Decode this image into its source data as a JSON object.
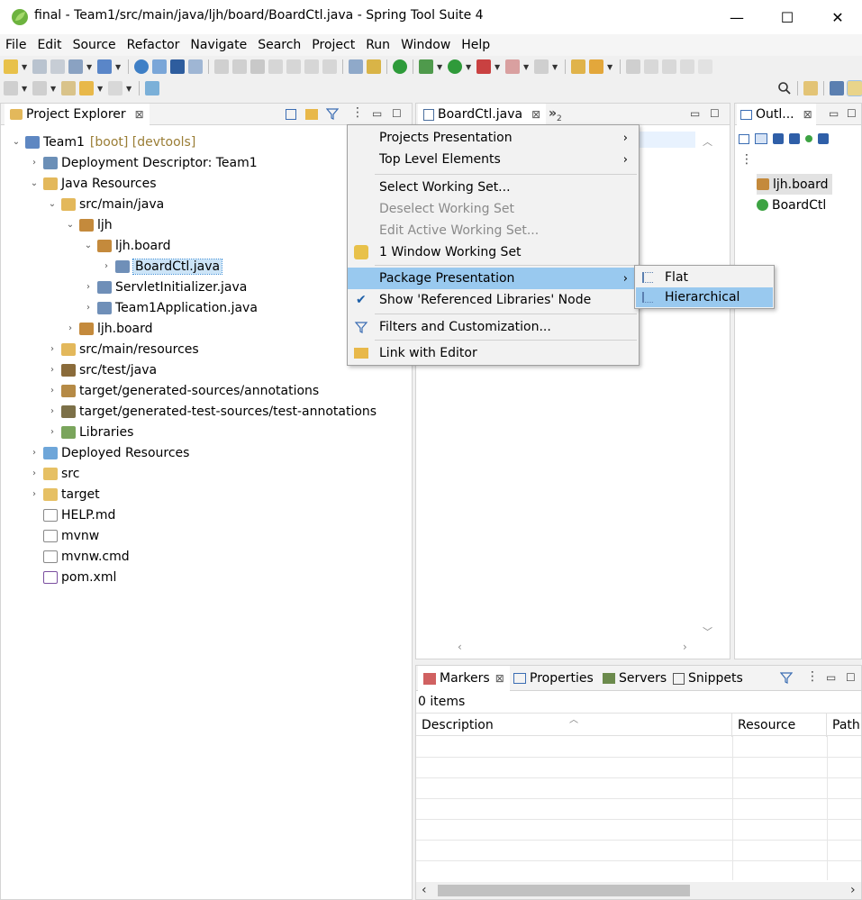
{
  "window": {
    "title": "final - Team1/src/main/java/ljh/board/BoardCtl.java - Spring Tool Suite 4",
    "minimize": "—",
    "maximize": "☐",
    "close": "✕"
  },
  "menubar": [
    "File",
    "Edit",
    "Source",
    "Refactor",
    "Navigate",
    "Search",
    "Project",
    "Run",
    "Window",
    "Help"
  ],
  "project_explorer": {
    "tab_label": "Project Explorer",
    "tab_close": "⊠",
    "tree": [
      {
        "label": "Team1",
        "decoration": "[boot] [devtools]",
        "expanded": true
      },
      {
        "label": "Deployment Descriptor: Team1"
      },
      {
        "label": "Java Resources",
        "expanded": true
      },
      {
        "label": "src/main/java",
        "expanded": true
      },
      {
        "label": "ljh",
        "expanded": true
      },
      {
        "label": "ljh.board",
        "expanded": true
      },
      {
        "label": "BoardCtl.java",
        "selected": true
      },
      {
        "label": "ServletInitializer.java"
      },
      {
        "label": "Team1Application.java"
      },
      {
        "label": "ljh.board"
      },
      {
        "label": "src/main/resources"
      },
      {
        "label": "src/test/java"
      },
      {
        "label": "target/generated-sources/annotations"
      },
      {
        "label": "target/generated-test-sources/test-annotations"
      },
      {
        "label": "Libraries"
      },
      {
        "label": "Deployed Resources"
      },
      {
        "label": "src"
      },
      {
        "label": "target"
      },
      {
        "label": "HELP.md"
      },
      {
        "label": "mvnw"
      },
      {
        "label": "mvnw.cmd"
      },
      {
        "label": "pom.xml"
      }
    ]
  },
  "editor": {
    "tab_label": "BoardCtl.java",
    "tab_close": "⊠",
    "overflow": "»",
    "overflow_count": "2"
  },
  "outline": {
    "tab_label": "Outl...",
    "tab_close": "⊠",
    "items": [
      "ljh.board",
      "BoardCtl"
    ]
  },
  "context_menu": {
    "items": [
      {
        "label": "Projects Presentation",
        "submenu": true
      },
      {
        "label": "Top Level Elements",
        "submenu": true
      },
      {
        "label": "Select Working Set..."
      },
      {
        "label": "Deselect Working Set",
        "disabled": true
      },
      {
        "label": "Edit Active Working Set...",
        "disabled": true
      },
      {
        "label": "1 Window Working Set"
      },
      {
        "label": "Package Presentation",
        "submenu": true,
        "highlighted": true
      },
      {
        "label": "Show 'Referenced Libraries' Node",
        "checked": true
      },
      {
        "label": "Filters and Customization..."
      },
      {
        "label": "Link with Editor"
      }
    ],
    "arrow": "›",
    "check": "✔"
  },
  "submenu": {
    "items": [
      {
        "label": "Flat"
      },
      {
        "label": "Hierarchical",
        "highlighted": true
      }
    ]
  },
  "bottom_panel": {
    "tabs": [
      "Markers",
      "Properties",
      "Servers",
      "Snippets"
    ],
    "tab_close": "⊠",
    "status": "0 items",
    "columns": [
      "Description",
      "Resource",
      "Path"
    ]
  },
  "colors": {
    "selection": "#cce4f7",
    "menu_highlight": "#99c9ef",
    "decoration": "#9a7d35",
    "spring_green": "#6db33f"
  }
}
